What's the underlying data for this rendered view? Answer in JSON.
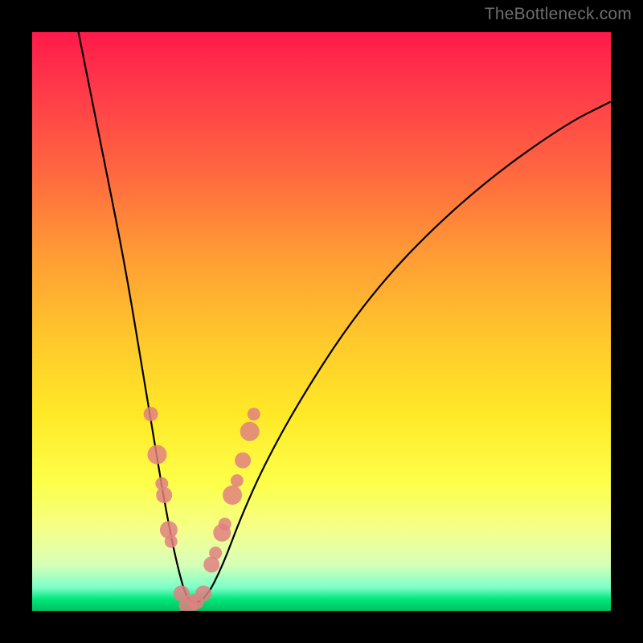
{
  "watermark": "TheBottleneck.com",
  "colors": {
    "gradient_top": "#ff1a4a",
    "gradient_mid": "#ffe927",
    "gradient_bottom": "#00c060",
    "curve": "#000000",
    "dots": "#e08080",
    "frame_bg": "#000000"
  },
  "chart_data": {
    "type": "line",
    "title": "",
    "xlabel": "",
    "ylabel": "",
    "xlim": [
      0,
      100
    ],
    "ylim": [
      0,
      100
    ],
    "note": "x/y in percent of plot area; y measured from bottom. Curve is a V-shaped bottleneck profile with minimum near x≈27. Background hue encodes value: red=high (bad), green=low (good).",
    "series": [
      {
        "name": "bottleneck-curve",
        "x": [
          8,
          12,
          16,
          19,
          21,
          23,
          25,
          27,
          30,
          33,
          36,
          40,
          46,
          55,
          65,
          78,
          92,
          100
        ],
        "y": [
          100,
          80,
          60,
          42,
          30,
          18,
          8,
          1,
          2,
          8,
          16,
          25,
          36,
          50,
          62,
          74,
          84,
          88
        ]
      }
    ],
    "markers": {
      "name": "highlighted-range-dots",
      "x": [
        20.5,
        21.6,
        22.4,
        22.8,
        23.6,
        24.0,
        25.8,
        27.0,
        28.3,
        29.6,
        31.0,
        31.7,
        32.8,
        33.3,
        34.6,
        35.4,
        36.4,
        37.6,
        38.3
      ],
      "y": [
        34,
        27,
        22,
        20,
        14,
        12,
        3,
        1,
        1.6,
        3,
        8,
        10,
        13.5,
        15,
        20,
        22.5,
        26,
        31,
        34
      ],
      "r": [
        9,
        12,
        8,
        10,
        11,
        8,
        10,
        12,
        10,
        10,
        10,
        8,
        11,
        8,
        12,
        8,
        10,
        12,
        8
      ]
    }
  }
}
